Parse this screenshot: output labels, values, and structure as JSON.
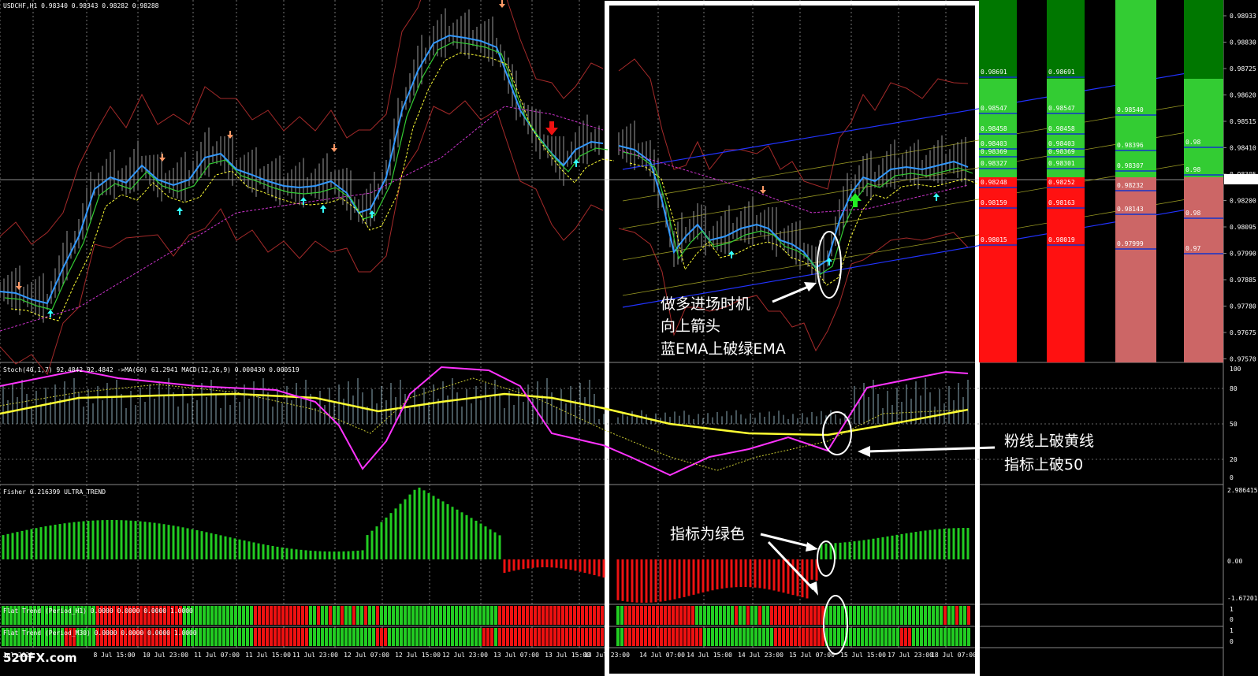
{
  "symbol_header": "USDCHF,H1  0.98340 0.98343 0.98282 0.98288",
  "current_price": "0.98288",
  "price_scale": [
    "0.98933",
    "0.98830",
    "0.98725",
    "0.98620",
    "0.98515",
    "0.98410",
    "0.98305",
    "0.98200",
    "0.98095",
    "0.97990",
    "0.97885",
    "0.97780",
    "0.97675",
    "0.97570"
  ],
  "stoch_header": "Stoch(40,1,7) 92.4842 92.4842  ->MA(60) 61.2941  MACD(12,26,9) 0.000430 0.000519",
  "stoch_scale": [
    "100",
    "80",
    "50",
    "20",
    "0"
  ],
  "fisher_header": "Fisher 0.216399  ULTRA_TREND",
  "fisher_scale": [
    "2.986415",
    "0.00",
    "-1.672019"
  ],
  "flat1_header": "Flat Trend (Period_H1) 0.0000 0.0000 0.0000 1.0000",
  "flat2_header": "Flat Trend (Period_M30) 0.0000 0.0000 0.0000 1.0000",
  "flat_scale": [
    "1",
    "0"
  ],
  "time_axis": [
    "7 Jul 2023",
    "8 Jul 15:00",
    "10 Jul 23:00",
    "11 Jul 07:00",
    "11 Jul 15:00",
    "11 Jul 23:00",
    "12 Jul 07:00",
    "12 Jul 15:00",
    "12 Jul 23:00",
    "13 Jul 07:00",
    "13 Jul 15:00",
    "13 Jul 23:00",
    "14 Jul 07:00",
    "14 Jul 15:00",
    "14 Jul 23:00",
    "15 Jul 07:00",
    "15 Jul 15:00",
    "17 Jul 23:00",
    "18 Jul 07:00"
  ],
  "watermark": "520FX.com",
  "level_columns": [
    {
      "labels": [
        "0.98691",
        "0.98547",
        "0.98458",
        "0.98403",
        "0.98369",
        "0.98327",
        "0.98248",
        "0.98159",
        "0.98015"
      ]
    },
    {
      "labels": [
        "0.98691",
        "0.98547",
        "0.98458",
        "0.98403",
        "0.98369",
        "0.98301",
        "0.98252",
        "0.98163",
        "0.98019"
      ]
    },
    {
      "labels": [
        "0.98540",
        "0.98396",
        "0.98307",
        "0.98232",
        "0.98143",
        "0.97999"
      ]
    },
    {
      "labels": [
        "0.98",
        "0.98",
        "0.98",
        "0.97"
      ]
    }
  ],
  "annotations": {
    "entry_line1": "做多进场时机",
    "entry_line2": "向上箭头",
    "entry_line3": "蓝EMA上破绿EMA",
    "stoch_line1": "粉线上破黄线",
    "stoch_line2": "指标上破50",
    "fisher_line": "指标为绿色"
  },
  "colors": {
    "bg": "#000000",
    "ema_blue": "#3399ff",
    "ema_green": "#33cc33",
    "ma_yellow": "#ffff33",
    "ma_magenta": "#cc33cc",
    "band": "#a52a2a",
    "stoch_pink": "#ff33ff",
    "bull": "#22cc22",
    "bear": "#ee1111"
  }
}
